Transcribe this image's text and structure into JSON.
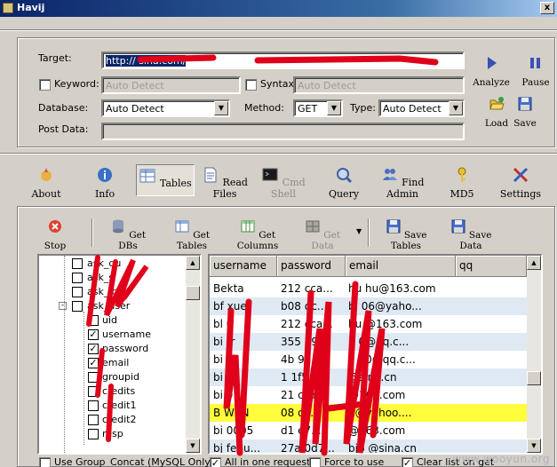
{
  "window": {
    "title": "Havij",
    "close": "x"
  },
  "target": {
    "label": "Target:",
    "value": "http://           sina.com/",
    "keyword_label": "Keyword:",
    "keyword_placeholder": "Auto Detect",
    "syntax_label": "Syntax:",
    "syntax_placeholder": "Auto Detect",
    "database_label": "Database:",
    "database_value": "Auto Detect",
    "method_label": "Method:",
    "method_value": "GET",
    "type_label": "Type:",
    "type_value": "Auto Detect",
    "postdata_label": "Post Data:"
  },
  "actions": {
    "analyze": "Analyze",
    "pause": "Pause",
    "load": "Load",
    "save": "Save"
  },
  "main_tools": [
    {
      "label": "About",
      "icon": "about-icon"
    },
    {
      "label": "Info",
      "icon": "info-icon"
    },
    {
      "label": "Tables",
      "icon": "tables-icon"
    },
    {
      "label": "Read Files",
      "icon": "read-files-icon"
    },
    {
      "label": "Cmd Shell",
      "icon": "cmd-shell-icon"
    },
    {
      "label": "Query",
      "icon": "query-icon"
    },
    {
      "label": "Find Admin",
      "icon": "find-admin-icon"
    },
    {
      "label": "MD5",
      "icon": "md5-icon"
    },
    {
      "label": "Settings",
      "icon": "settings-icon"
    }
  ],
  "tables_toolbar": {
    "stop": "Stop",
    "get_dbs": "Get DBs",
    "get_tables": "Get Tables",
    "get_columns": "Get Columns",
    "get_data": "Get Data",
    "save_tables": "Save Tables",
    "save_data": "Save Data"
  },
  "tree": {
    "tables": [
      "ask_qu",
      "ask_s",
      "ask_    g",
      "ask_user"
    ],
    "columns": [
      {
        "name": "uid",
        "checked": false
      },
      {
        "name": "username",
        "checked": true
      },
      {
        "name": "password",
        "checked": true
      },
      {
        "name": "email",
        "checked": true
      },
      {
        "name": "groupid",
        "checked": false
      },
      {
        "name": "credits",
        "checked": false
      },
      {
        "name": "credit1",
        "checked": false
      },
      {
        "name": "credit2",
        "checked": false
      },
      {
        "name": "resp",
        "checked": false
      }
    ]
  },
  "grid": {
    "columns": [
      "username",
      "password",
      "email",
      "qq"
    ],
    "rows": [
      [
        "Bekta   ",
        "212  cca...",
        "hu    hu@163.com",
        ""
      ],
      [
        "bf    xue",
        "b08   dc...",
        "bl    06@yaho...",
        ""
      ],
      [
        "bl     0",
        "212  cca...",
        "hu        @163.com",
        ""
      ],
      [
        "bi    tr",
        "355   79...",
        "1       0@qq.c...",
        ""
      ],
      [
        "bi     u",
        "4b   9d...",
        "1        20@qq.c...",
        ""
      ],
      [
        "bi     0",
        "1   1f5...",
        "        @sina.cn",
        ""
      ],
      [
        "bi     9",
        "21   cca...",
        "        @163.com",
        ""
      ],
      [
        "B     WEN",
        "08    dc...",
        "         5@yahoo....",
        ""
      ],
      [
        "bi    0005",
        "d1    e7...",
        "         @163.com",
        ""
      ],
      [
        "bj    fedu...",
        "27a   0d7...",
        "bjb      @sina.cn",
        ""
      ]
    ],
    "selected_row": 7
  },
  "options": {
    "use_group_concat": "Use Group_Concat (MySQL Only)",
    "all_in_one": "All in one request.",
    "force_to_use": "Force to use",
    "clear_list": "Clear list on get"
  },
  "watermark": "www.wooyun.org"
}
